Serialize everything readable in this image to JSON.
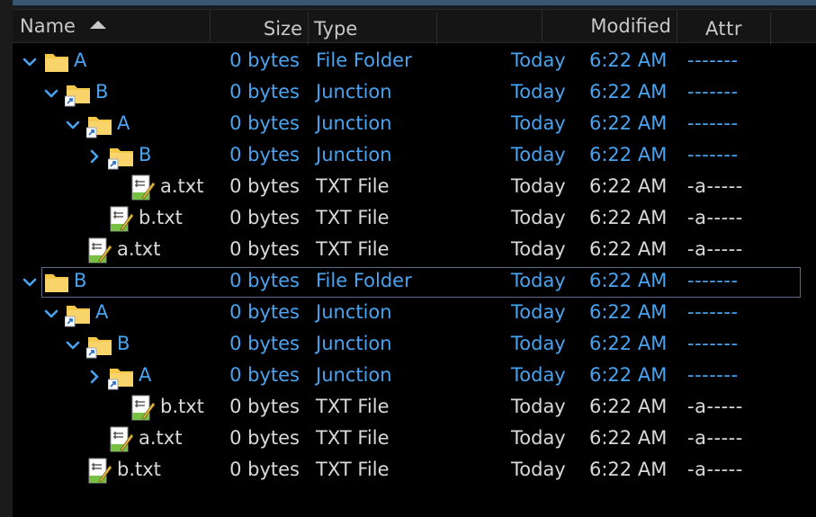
{
  "colors": {
    "folder_text": "#4aa3ef",
    "file_text": "#d9d9d9",
    "background": "#000000",
    "header_bg": "#151515",
    "folder_icon": "#f4c84a",
    "chevron": "#4aa3ef"
  },
  "columns": {
    "name": "Name",
    "size": "Size",
    "type": "Type",
    "modified": "Modified",
    "attr": "Attr"
  },
  "rows": [
    {
      "level": 0,
      "kind": "folder",
      "chevron": "down",
      "icon": "folder-icon",
      "name": "A",
      "size": "0 bytes",
      "type": "File Folder",
      "modified_day": "Today",
      "modified_time": "6:22 AM",
      "attr": "-------"
    },
    {
      "level": 1,
      "kind": "folder",
      "chevron": "down",
      "icon": "junction-icon",
      "name": "B",
      "size": "0 bytes",
      "type": "Junction",
      "modified_day": "Today",
      "modified_time": "6:22 AM",
      "attr": "-------"
    },
    {
      "level": 2,
      "kind": "folder",
      "chevron": "down",
      "icon": "junction-icon",
      "name": "A",
      "size": "0 bytes",
      "type": "Junction",
      "modified_day": "Today",
      "modified_time": "6:22 AM",
      "attr": "-------"
    },
    {
      "level": 3,
      "kind": "folder",
      "chevron": "right",
      "icon": "junction-icon",
      "name": "B",
      "size": "0 bytes",
      "type": "Junction",
      "modified_day": "Today",
      "modified_time": "6:22 AM",
      "attr": "-------"
    },
    {
      "level": 4,
      "kind": "file",
      "chevron": "none",
      "icon": "text-file-icon",
      "name": "a.txt",
      "size": "0 bytes",
      "type": "TXT File",
      "modified_day": "Today",
      "modified_time": "6:22 AM",
      "attr": "-a-----"
    },
    {
      "level": 3,
      "kind": "file",
      "chevron": "none",
      "icon": "text-file-icon",
      "name": "b.txt",
      "size": "0 bytes",
      "type": "TXT File",
      "modified_day": "Today",
      "modified_time": "6:22 AM",
      "attr": "-a-----"
    },
    {
      "level": 2,
      "kind": "file",
      "chevron": "none",
      "icon": "text-file-icon",
      "name": "a.txt",
      "size": "0 bytes",
      "type": "TXT File",
      "modified_day": "Today",
      "modified_time": "6:22 AM",
      "attr": "-a-----"
    },
    {
      "level": 0,
      "kind": "folder",
      "chevron": "down",
      "icon": "folder-icon",
      "name": "B",
      "size": "0 bytes",
      "type": "File Folder",
      "modified_day": "Today",
      "modified_time": "6:22 AM",
      "attr": "-------",
      "selected": true
    },
    {
      "level": 1,
      "kind": "folder",
      "chevron": "down",
      "icon": "junction-icon",
      "name": "A",
      "size": "0 bytes",
      "type": "Junction",
      "modified_day": "Today",
      "modified_time": "6:22 AM",
      "attr": "-------"
    },
    {
      "level": 2,
      "kind": "folder",
      "chevron": "down",
      "icon": "junction-icon",
      "name": "B",
      "size": "0 bytes",
      "type": "Junction",
      "modified_day": "Today",
      "modified_time": "6:22 AM",
      "attr": "-------"
    },
    {
      "level": 3,
      "kind": "folder",
      "chevron": "right",
      "icon": "junction-icon",
      "name": "A",
      "size": "0 bytes",
      "type": "Junction",
      "modified_day": "Today",
      "modified_time": "6:22 AM",
      "attr": "-------"
    },
    {
      "level": 4,
      "kind": "file",
      "chevron": "none",
      "icon": "text-file-icon",
      "name": "b.txt",
      "size": "0 bytes",
      "type": "TXT File",
      "modified_day": "Today",
      "modified_time": "6:22 AM",
      "attr": "-a-----"
    },
    {
      "level": 3,
      "kind": "file",
      "chevron": "none",
      "icon": "text-file-icon",
      "name": "a.txt",
      "size": "0 bytes",
      "type": "TXT File",
      "modified_day": "Today",
      "modified_time": "6:22 AM",
      "attr": "-a-----"
    },
    {
      "level": 2,
      "kind": "file",
      "chevron": "none",
      "icon": "text-file-icon",
      "name": "b.txt",
      "size": "0 bytes",
      "type": "TXT File",
      "modified_day": "Today",
      "modified_time": "6:22 AM",
      "attr": "-a-----"
    }
  ]
}
